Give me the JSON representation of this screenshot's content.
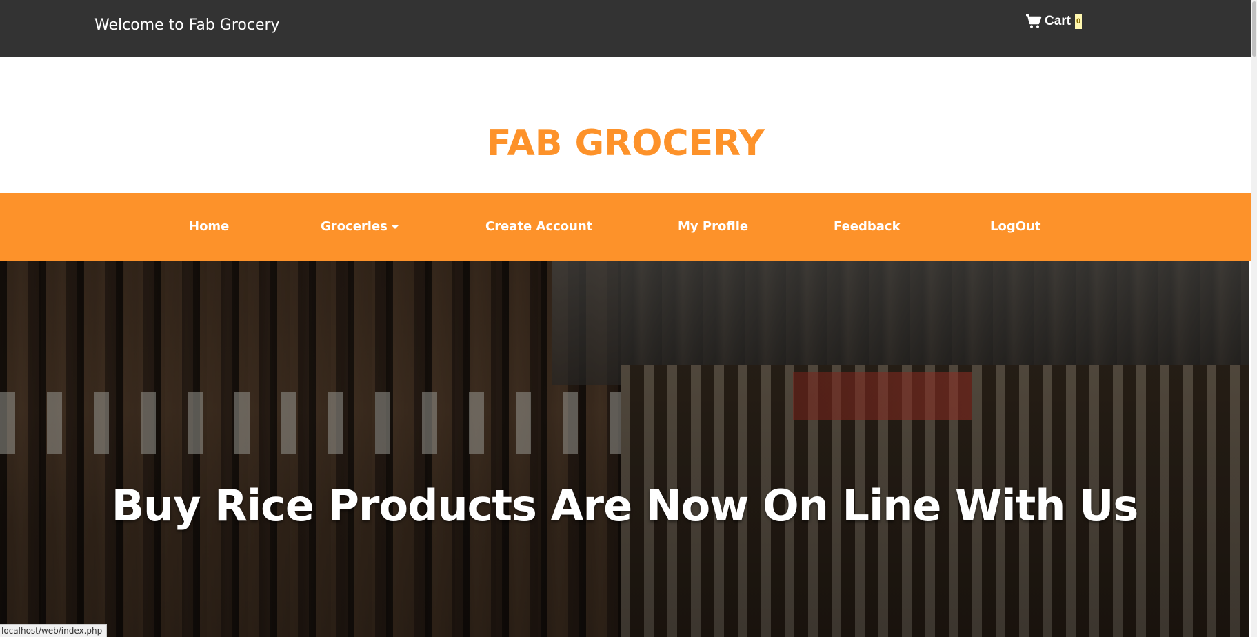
{
  "topbar": {
    "welcome": "Welcome to Fab Grocery",
    "cart_label": "Cart",
    "cart_icon": "shopping-cart-icon",
    "cart_count": "0"
  },
  "brand": {
    "title": "FAB GROCERY",
    "color": "#fd922a"
  },
  "nav": {
    "color": "#fd922a",
    "items": [
      {
        "label": "Home"
      },
      {
        "label": "Groceries",
        "has_dropdown": true
      },
      {
        "label": "Create Account"
      },
      {
        "label": "My Profile"
      },
      {
        "label": "Feedback"
      },
      {
        "label": "LogOut"
      }
    ]
  },
  "hero": {
    "title": "Buy Rice Products Are Now On Line With Us"
  },
  "status_bar": {
    "url": "localhost/web/index.php"
  }
}
